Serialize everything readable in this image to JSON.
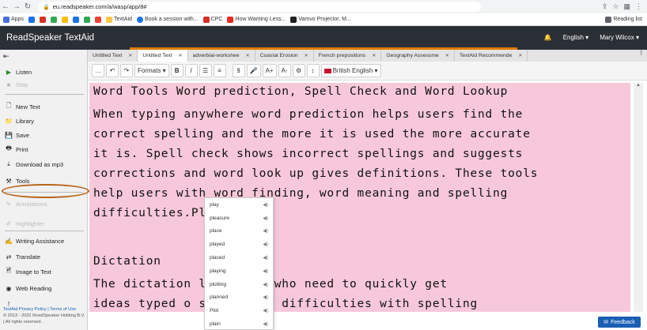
{
  "browser": {
    "url": "eu.readspeaker.com/a/wasp/app/8#",
    "bookmarks": [
      {
        "label": "Apps"
      },
      {
        "label": "TextAid"
      },
      {
        "label": "Book a session with..."
      },
      {
        "label": "CPC"
      },
      {
        "label": "How Wanting Less..."
      },
      {
        "label": "Vamvo Projector, M..."
      }
    ],
    "reading_list": "Reading list"
  },
  "header": {
    "title": "ReadSpeaker TextAid",
    "language": "English",
    "user": "Mary Wilcox"
  },
  "sidebar": {
    "items": [
      {
        "label": "Listen"
      },
      {
        "label": "Stop"
      },
      {
        "label": "New Text"
      },
      {
        "label": "Library"
      },
      {
        "label": "Save"
      },
      {
        "label": "Print"
      },
      {
        "label": "Download as mp3"
      },
      {
        "label": "Tools"
      },
      {
        "label": "Annotations"
      },
      {
        "label": "Highlighter"
      },
      {
        "label": "Writing Assistance"
      },
      {
        "label": "Translate"
      },
      {
        "label": "Image to Text"
      },
      {
        "label": "Web Reading"
      }
    ],
    "footer_links": "TextAid Privacy Policy | Terms of Use",
    "footer_copyright": "© 2013 - 2022 ReadSpeaker Holding B.V. | All rights reserved."
  },
  "tabs": [
    {
      "label": "Untitled Text"
    },
    {
      "label": "Untitled Text"
    },
    {
      "label": "adverbial-workshee"
    },
    {
      "label": "Coastal Erosion"
    },
    {
      "label": "French prepositions"
    },
    {
      "label": "Geography Assessme"
    },
    {
      "label": "TextAid Recommende"
    }
  ],
  "toolbar": {
    "formats": "Formats",
    "language": "British English"
  },
  "editor": {
    "lines": [
      "Word Tools Word prediction, Spell Check and Word Lookup",
      "When typing anywhere word prediction helps users find the",
      "correct spelling and the more it is used the more accurate",
      "it is. Spell check shows incorrect spellings and suggests",
      "corrections and word look up gives definitions. These tools",
      "help users with word finding, word meaning and spelling",
      "difficulties.Pl",
      "",
      "",
      "Dictation",
      "The dictation         lps users who need to quickly get",
      "ideas typed  o    screen but difficulties with spelling"
    ]
  },
  "suggestions": [
    "play",
    "pleasure",
    "place",
    "played",
    "placed",
    "playing",
    "plotting",
    "planned",
    "Plot",
    "plain"
  ],
  "feedback_label": "Feedback"
}
